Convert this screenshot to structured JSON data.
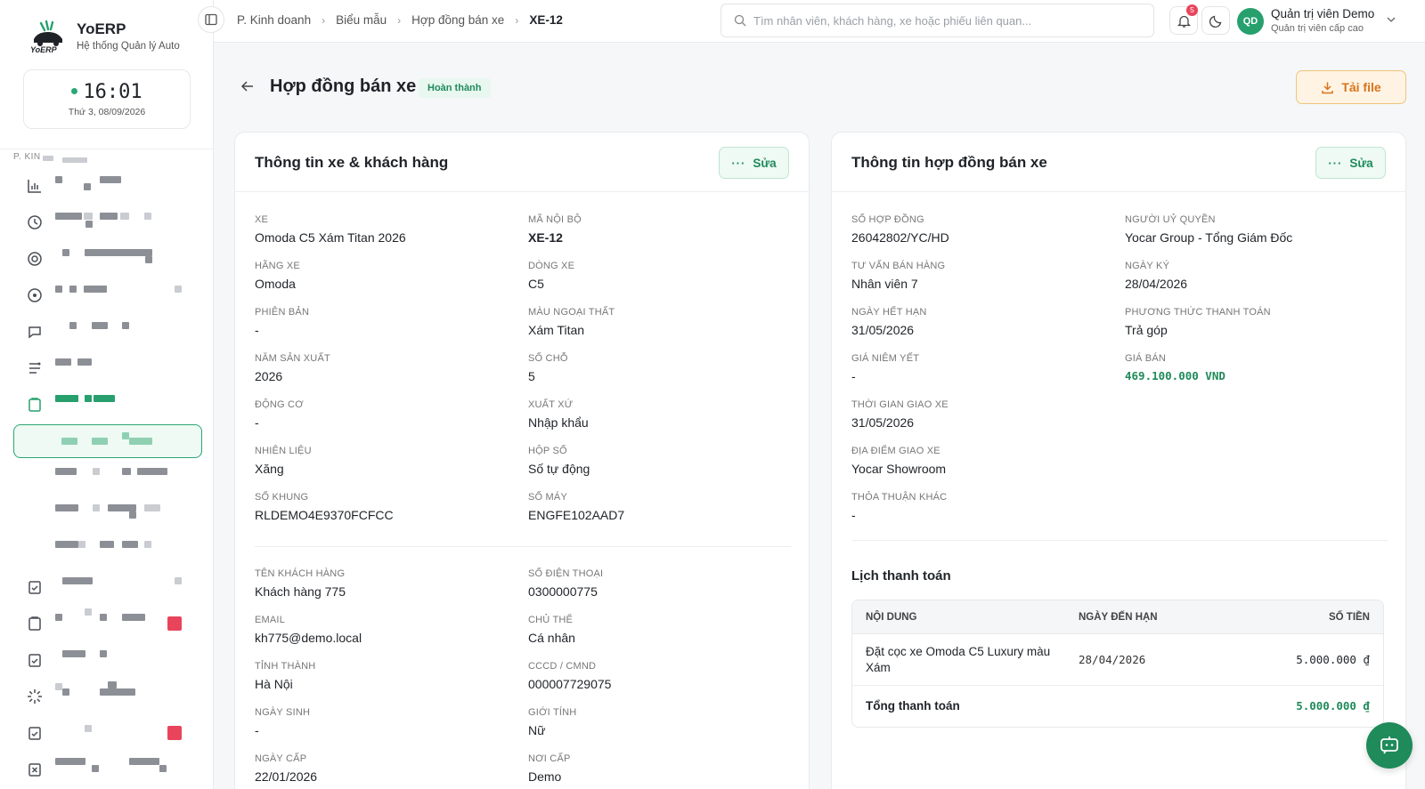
{
  "brand": {
    "name": "YoERP",
    "subtitle": "Hệ thống Quản lý Auto",
    "logo_text": "YoERP"
  },
  "clock": {
    "time": "16:01",
    "date": "Thứ 3, 08/09/2026"
  },
  "sidebar": {
    "section_label": "P. KIN"
  },
  "breadcrumb": {
    "items": [
      "P. Kinh doanh",
      "Biểu mẫu",
      "Hợp đồng bán xe"
    ],
    "current": "XE-12"
  },
  "search": {
    "placeholder": "Tìm nhân viên, khách hàng, xe hoặc phiếu liên quan..."
  },
  "notifications": {
    "count": "5"
  },
  "user": {
    "initials": "QD",
    "name": "Quản trị viên Demo",
    "role": "Quản trị viên cấp cao"
  },
  "page": {
    "title": "Hợp đồng bán xe",
    "status": "Hoàn thành",
    "download_label": "Tải file"
  },
  "colors": {
    "accent": "#27a06e",
    "warning": "#d9731a",
    "danger": "#e8455c"
  },
  "left_card": {
    "title": "Thông tin xe & khách hàng",
    "edit_label": "Sửa",
    "vehicle_fields": [
      {
        "label": "Xe",
        "value": "Omoda C5 Xám Titan 2026"
      },
      {
        "label": "Mã nội bộ",
        "value": "XE-12"
      },
      {
        "label": "Hãng xe",
        "value": "Omoda"
      },
      {
        "label": "Dòng xe",
        "value": "C5"
      },
      {
        "label": "Phiên bản",
        "value": "-"
      },
      {
        "label": "Màu ngoại thất",
        "value": "Xám Titan"
      },
      {
        "label": "Năm sản xuất",
        "value": "2026"
      },
      {
        "label": "Số chỗ",
        "value": "5"
      },
      {
        "label": "Động cơ",
        "value": "-"
      },
      {
        "label": "Xuất xứ",
        "value": "Nhập khẩu"
      },
      {
        "label": "Nhiên liệu",
        "value": "Xăng"
      },
      {
        "label": "Hộp số",
        "value": "Số tự động"
      },
      {
        "label": "Số khung",
        "value": "RLDEMO4E9370FCFCC"
      },
      {
        "label": "Số máy",
        "value": "ENGFE102AAD7"
      }
    ],
    "customer_fields": [
      {
        "label": "Tên khách hàng",
        "value": "Khách hàng 775"
      },
      {
        "label": "Số điện thoại",
        "value": "0300000775"
      },
      {
        "label": "Email",
        "value": "kh775@demo.local"
      },
      {
        "label": "Chủ thể",
        "value": "Cá nhân"
      },
      {
        "label": "Tỉnh thành",
        "value": "Hà Nội"
      },
      {
        "label": "CCCD / CMND",
        "value": "000007729075"
      },
      {
        "label": "Ngày sinh",
        "value": "-"
      },
      {
        "label": "Giới tính",
        "value": "Nữ"
      },
      {
        "label": "Ngày cấp",
        "value": "22/01/2026"
      },
      {
        "label": "Nơi cấp",
        "value": "Demo"
      }
    ]
  },
  "right_card": {
    "title": "Thông tin hợp đồng bán xe",
    "edit_label": "Sửa",
    "fields": [
      {
        "label": "Số hợp đồng",
        "value": "26042802/YC/HD"
      },
      {
        "label": "Người uỷ quyền",
        "value": "Yocar Group - Tổng Giám Đốc"
      },
      {
        "label": "Tư vấn bán hàng",
        "value": "Nhân viên 7"
      },
      {
        "label": "Ngày ký",
        "value": "28/04/2026"
      },
      {
        "label": "Ngày hết hạn",
        "value": "31/05/2026"
      },
      {
        "label": "Phương thức thanh toán",
        "value": "Trả góp"
      },
      {
        "label": "Giá niêm yết",
        "value": "-"
      },
      {
        "label": "Giá bán",
        "value": "469.100.000 VND"
      },
      {
        "label": "Thời gian giao xe",
        "value": "31/05/2026"
      },
      {
        "label": "Địa điểm giao xe",
        "value": "Yocar Showroom"
      },
      {
        "label": "Thỏa thuận khác",
        "value": "-"
      }
    ],
    "schedule": {
      "title": "Lịch thanh toán",
      "headers": [
        "Nội dung",
        "Ngày đến hạn",
        "Số tiền"
      ],
      "rows": [
        {
          "content": "Đặt cọc xe Omoda C5 Luxury màu Xám",
          "due": "28/04/2026",
          "amount": "5.000.000 ₫"
        }
      ],
      "total_label": "Tổng thanh toán",
      "total_amount": "5.000.000 ₫"
    }
  }
}
